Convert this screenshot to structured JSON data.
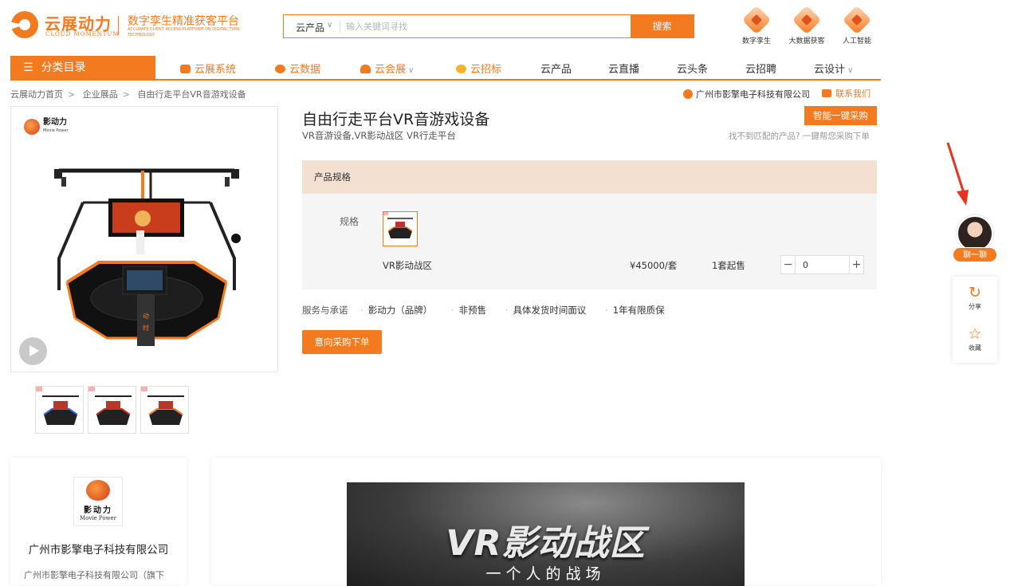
{
  "header": {
    "brand_name": "云展动力",
    "brand_en": "CLOUD MOMENTUM",
    "slogan": "数字孪生精准获客平台",
    "slogan_en": "ACCURATE CLIENT ACCESS PLATFORM ON DIGITAL TWIN TECHNOLOGY",
    "search": {
      "category": "云产品",
      "placeholder": "输入关键词寻找",
      "button": "搜索"
    },
    "top_icons": [
      {
        "label": "数字孪生",
        "icon": "digital-twin-icon"
      },
      {
        "label": "大数据获客",
        "icon": "big-data-icon"
      },
      {
        "label": "人工智能",
        "icon": "ai-icon"
      }
    ]
  },
  "nav": {
    "category_menu": "分类目录",
    "items": [
      {
        "label": "云展系统",
        "icon": "exhibition-icon"
      },
      {
        "label": "云数据",
        "icon": "cloud-data-icon"
      },
      {
        "label": "云会展",
        "icon": "conference-icon"
      },
      {
        "label": "云招标",
        "icon": "bidding-icon"
      },
      {
        "label": "云产品"
      },
      {
        "label": "云直播"
      },
      {
        "label": "云头条"
      },
      {
        "label": "云招聘"
      },
      {
        "label": "云设计"
      }
    ]
  },
  "breadcrumb": [
    "云展动力首页",
    "企业展品",
    "自由行走平台VR音游戏设备"
  ],
  "breadcrumb_sep": ">",
  "company": {
    "name": "广州市影擎电子科技有限公司",
    "contact": "联系我们"
  },
  "gallery": {
    "brand_cn": "影动力",
    "brand_en": "Movie Power",
    "thumbnails": 3
  },
  "product": {
    "title": "自由行走平台VR音游戏设备",
    "subtitle": "VR音游设备,VR影动战区 VR行走平台",
    "smart_button": "智能一键采购",
    "not_found": "找不到匹配的产品? 一键帮您采购下单",
    "spec": {
      "header": "产品规格",
      "label": "规格",
      "option_name": "VR影动战区",
      "price": "¥45000/套",
      "min_order": "1套起售",
      "quantity": "0",
      "minus": "−",
      "plus": "+"
    },
    "promise_label": "服务与承诺",
    "promises": [
      "影动力（品牌）",
      "非预售",
      "具体发货时间面议",
      "1年有限质保"
    ],
    "order_button": "意向采购下单"
  },
  "floating": {
    "chat": "聊一聊",
    "share": "分享",
    "favorite": "收藏"
  },
  "company_card": {
    "name": "广州市影擎电子科技有限公司",
    "sub": "广州市影擎电子科技有限公司（旗下",
    "logo_cn": "影动力",
    "logo_en": "Movie Power"
  },
  "banner": {
    "title": "VR影动战区",
    "subtitle": "一个人的战场"
  },
  "colors": {
    "accent": "#f47a20",
    "spec_header_bg": "#f3e0d0",
    "arrow": "#e53421"
  }
}
